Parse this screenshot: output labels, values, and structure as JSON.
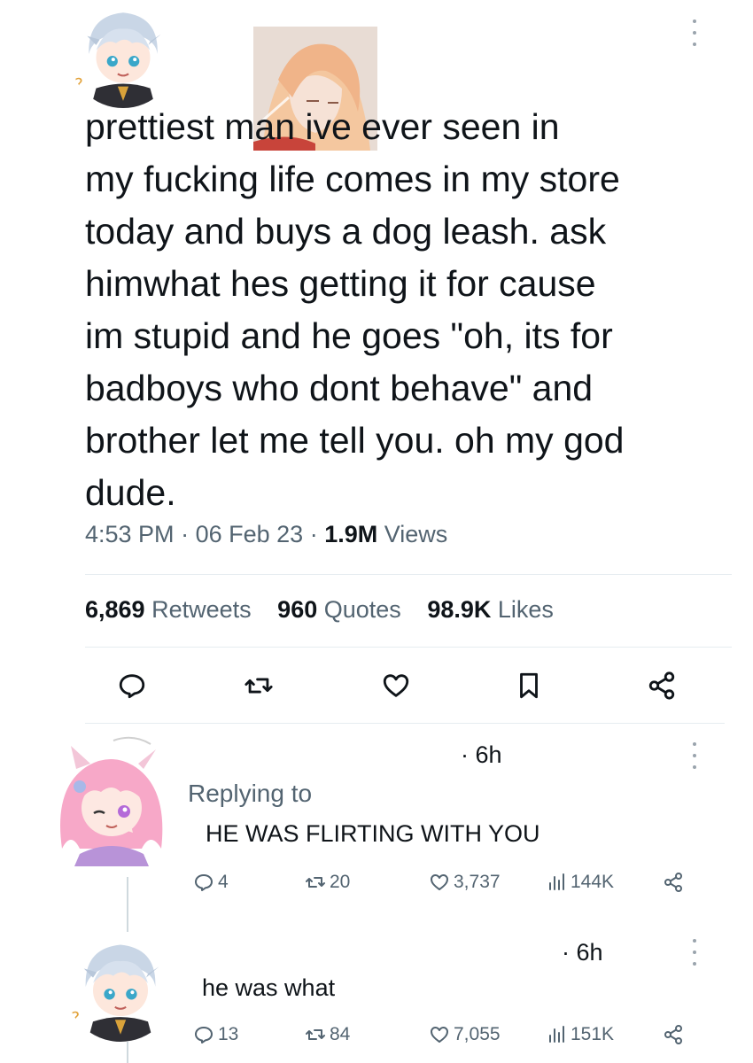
{
  "main_tweet": {
    "lines": [
      "prettiest          man ive ever seen in",
      "my fucking life comes in my store",
      "today and buys a dog leash. ask",
      "himwhat   hes getting it for cause",
      "im stupid and   he goes \"oh, its for",
      "badboys who dont behave\" and",
      "brother let me tell you. oh my god",
      "dude."
    ],
    "time": "4:53 PM",
    "date": "06 Feb 23",
    "views_count": "1.9M",
    "views_label": "Views",
    "retweets_count": "6,869",
    "retweets_label": "Retweets",
    "quotes_count": "960",
    "quotes_label": "Quotes",
    "likes_count": "98.9K",
    "likes_label": "Likes",
    "sep": "·"
  },
  "reply1": {
    "time": "· 6h",
    "replying_label": "Replying to",
    "text": "HE WAS FLIRTING WITH YOU",
    "replies": "4",
    "retweets": "20",
    "likes": "3,737",
    "views": "144K"
  },
  "reply2": {
    "time": "· 6h",
    "text": "he was what",
    "replies": "13",
    "retweets": "84",
    "likes": "7,055",
    "views": "151K"
  },
  "colors": {
    "text": "#0f1419",
    "muted": "#536471",
    "divider": "#e6ecf0",
    "icon": "#0f1419"
  },
  "icons": {
    "reply": "speech-bubble-icon",
    "retweet": "retweet-arrows-icon",
    "like": "heart-icon",
    "bookmark": "bookmark-icon",
    "share": "share-nodes-icon",
    "views": "bar-chart-icon",
    "more": "vertical-dots-icon"
  }
}
